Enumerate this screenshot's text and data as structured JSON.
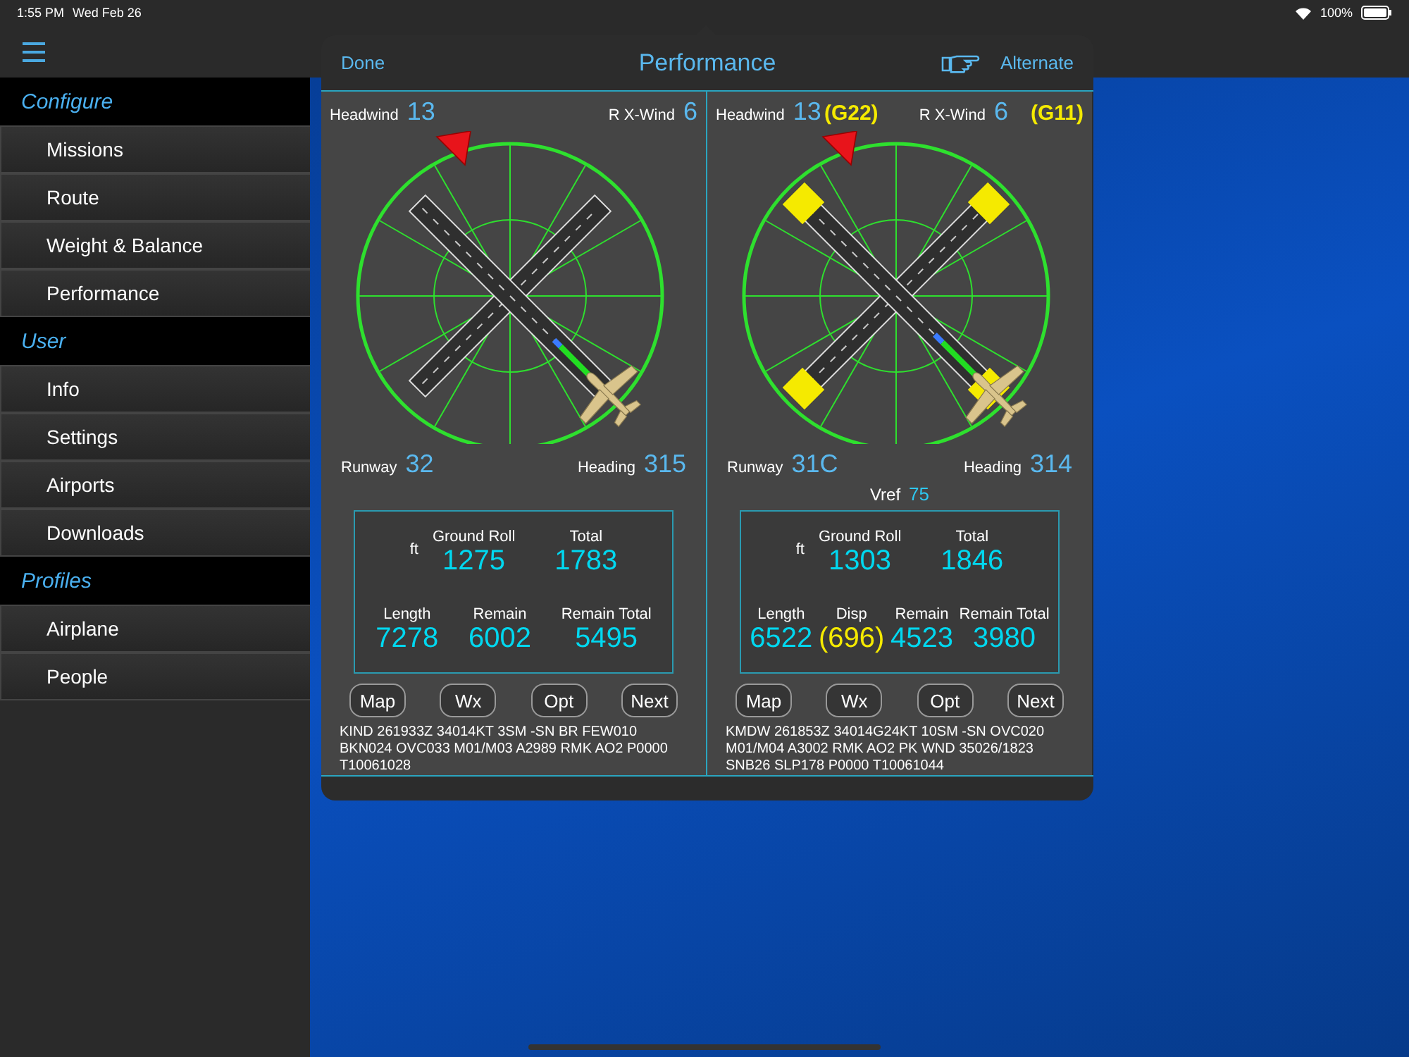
{
  "status_bar": {
    "time": "1:55 PM",
    "date": "Wed Feb 26",
    "battery": "100%"
  },
  "sidebar": {
    "sections": [
      {
        "title": "Configure",
        "items": [
          "Missions",
          "Route",
          "Weight & Balance",
          "Performance"
        ]
      },
      {
        "title": "User",
        "items": [
          "Info",
          "Settings",
          "Airports",
          "Downloads"
        ]
      },
      {
        "title": "Profiles",
        "items": [
          "Airplane",
          "People"
        ]
      }
    ]
  },
  "popover": {
    "title": "Performance",
    "done": "Done",
    "alternate": "Alternate",
    "panels": [
      {
        "headwind_label": "Headwind",
        "headwind": "13",
        "crosswind_label": "R X-Wind",
        "crosswind": "6",
        "runway_label": "Runway",
        "runway": "32",
        "heading_label": "Heading",
        "heading": "315",
        "threshold_markers": false,
        "unit": "ft",
        "top_results": [
          {
            "label": "Ground Roll",
            "value": "1275"
          },
          {
            "label": "Total",
            "value": "1783"
          }
        ],
        "bottom_results": [
          {
            "label": "Length",
            "value": "7278",
            "kind": "normal"
          },
          {
            "label": "Remain",
            "value": "6002",
            "kind": "normal"
          },
          {
            "label": "Remain Total",
            "value": "5495",
            "kind": "normal"
          }
        ],
        "buttons": [
          "Map",
          "Wx",
          "Opt",
          "Next"
        ],
        "metar": "KIND 261933Z 34014KT 3SM -SN BR FEW010 BKN024 OVC033 M01/M03 A2989 RMK AO2 P0000 T10061028"
      },
      {
        "headwind_label": "Headwind",
        "headwind": "13",
        "headwind_gust": "(G22)",
        "crosswind_label": "R X-Wind",
        "crosswind": "6",
        "crosswind_gust": "(G11)",
        "runway_label": "Runway",
        "runway": "31C",
        "heading_label": "Heading",
        "heading": "314",
        "vref_label": "Vref",
        "vref": "75",
        "threshold_markers": true,
        "unit": "ft",
        "top_results": [
          {
            "label": "Ground Roll",
            "value": "1303"
          },
          {
            "label": "Total",
            "value": "1846"
          }
        ],
        "bottom_results": [
          {
            "label": "Length",
            "value": "6522",
            "kind": "normal"
          },
          {
            "label": "Disp",
            "value": "(696)",
            "kind": "displaced"
          },
          {
            "label": "Remain",
            "value": "4523",
            "kind": "normal"
          },
          {
            "label": "Remain Total",
            "value": "3980",
            "kind": "normal"
          }
        ],
        "buttons": [
          "Map",
          "Wx",
          "Opt",
          "Next"
        ],
        "metar": "KMDW 261853Z 34014G24KT 10SM -SN OVC020 M01/M04 A3002 RMK AO2 PK WND 35026/1823 SNB26 SLP178 P0000 T10061044"
      }
    ]
  }
}
